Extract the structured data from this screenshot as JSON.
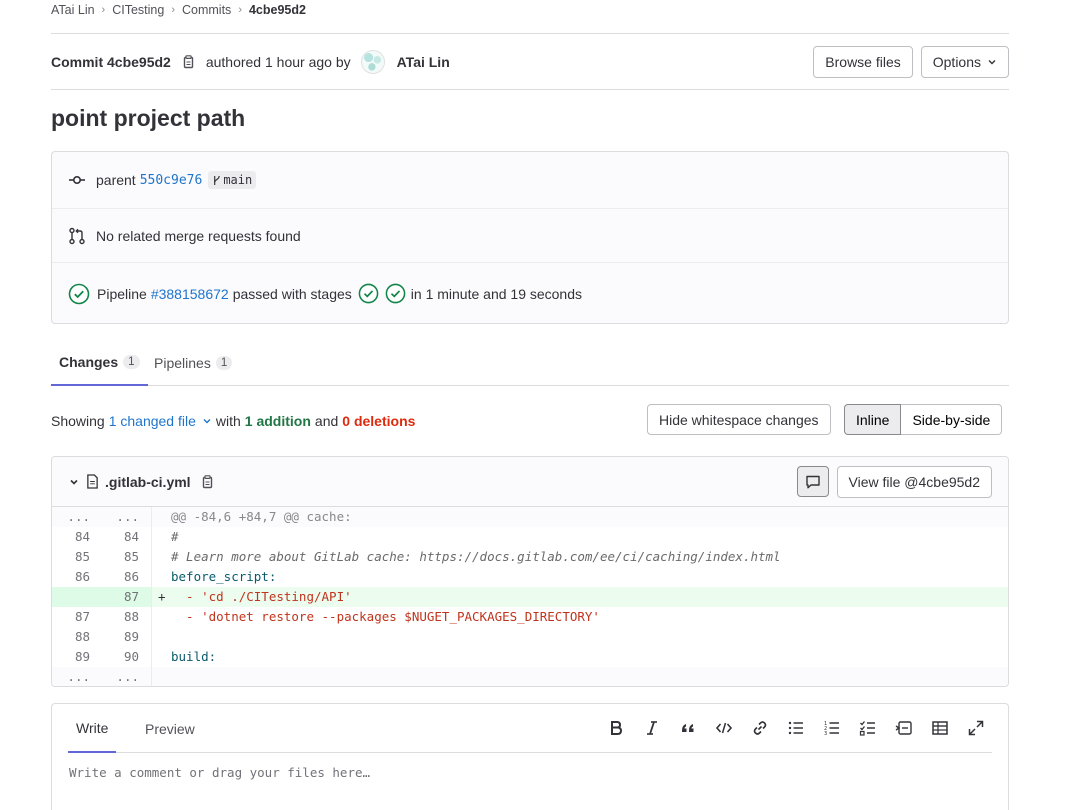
{
  "breadcrumb": [
    "ATai Lin",
    "CITesting",
    "Commits",
    "4cbe95d2"
  ],
  "commit": {
    "title": "Commit 4cbe95d2",
    "authored": "authored 1 hour ago by",
    "author": "ATai Lin",
    "browse_files": "Browse files",
    "options": "Options"
  },
  "page_title": "point project path",
  "info": {
    "parent_label": "parent",
    "parent_sha": "550c9e76",
    "branch": "main",
    "merge_requests": "No related merge requests found",
    "pipeline_label": "Pipeline",
    "pipeline_id": "#388158672",
    "passed_with_stages": "passed with stages",
    "duration": "in 1 minute and 19 seconds"
  },
  "tabs": [
    {
      "label": "Changes",
      "count": "1"
    },
    {
      "label": "Pipelines",
      "count": "1"
    }
  ],
  "showing": {
    "prefix": "Showing",
    "changed_file": "1 changed file",
    "with": "with",
    "additions": "1 addition",
    "and": "and",
    "deletions": "0 deletions",
    "hide_whitespace": "Hide whitespace changes",
    "inline": "Inline",
    "side_by_side": "Side-by-side"
  },
  "diff": {
    "filename": ".gitlab-ci.yml",
    "view_file": "View file @4cbe95d2",
    "hunk": "@@ -84,6 +84,7 @@ cache:",
    "ellipsis": "...",
    "lines": [
      {
        "old": "84",
        "new": "84",
        "code": "#"
      },
      {
        "old": "85",
        "new": "85",
        "code": "# Learn more about GitLab cache: https://docs.gitlab.com/ee/ci/caching/index.html"
      },
      {
        "old": "86",
        "new": "86",
        "code": "before_script:"
      },
      {
        "old": "",
        "new": "87",
        "marker": "+",
        "code": "  - 'cd ./CITesting/API'"
      },
      {
        "old": "87",
        "new": "88",
        "code": "  - 'dotnet restore --packages $NUGET_PACKAGES_DIRECTORY'"
      },
      {
        "old": "88",
        "new": "89",
        "code": ""
      },
      {
        "old": "89",
        "new": "90",
        "code": "build:"
      }
    ]
  },
  "comment": {
    "write": "Write",
    "preview": "Preview",
    "placeholder": "Write a comment or drag your files here…"
  },
  "colors": {
    "link": "#1f75cb",
    "success": "#108548",
    "tab_underline": "#6366d6",
    "addition_bg": "#ecfdf0"
  }
}
